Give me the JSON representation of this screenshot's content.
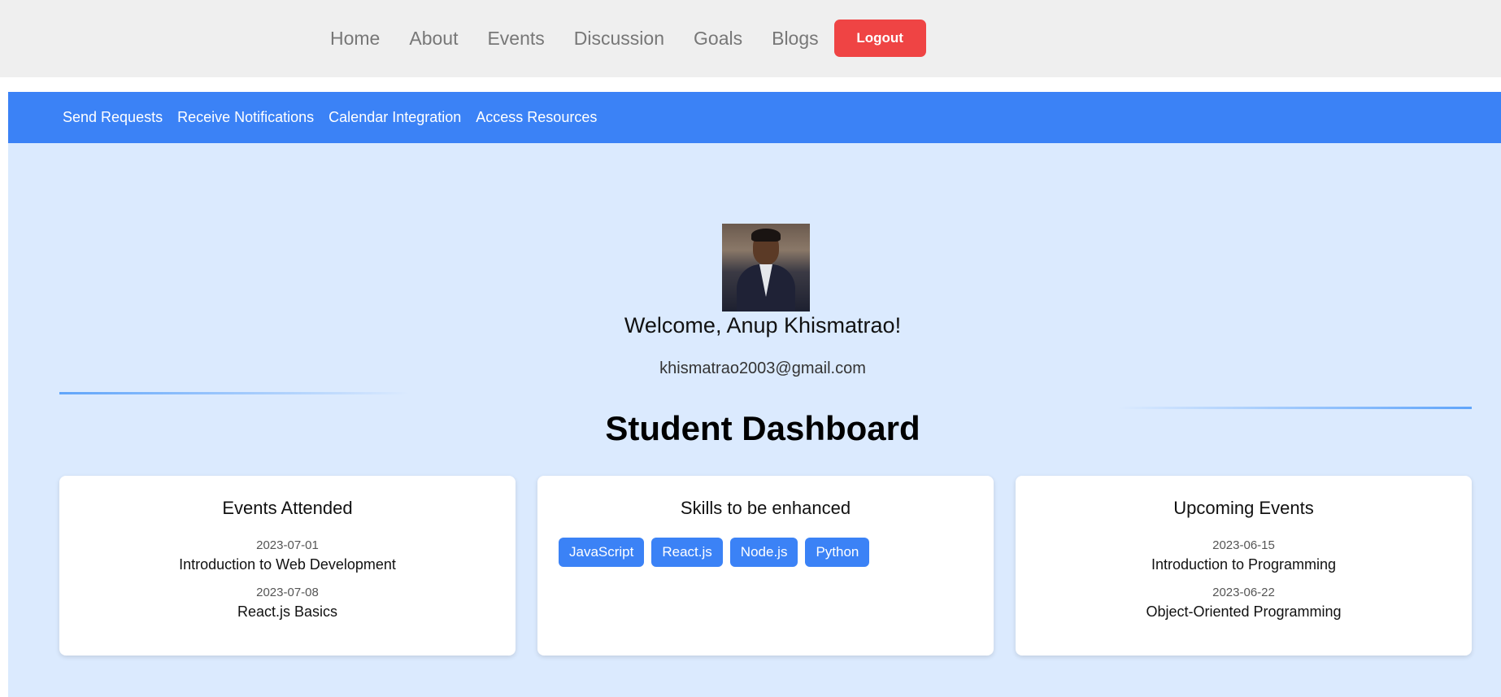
{
  "topnav": {
    "links": [
      "Home",
      "About",
      "Events",
      "Discussion",
      "Goals",
      "Blogs"
    ],
    "logout_label": "Logout"
  },
  "subnav": {
    "links": [
      "Send Requests",
      "Receive Notifications",
      "Calendar Integration",
      "Access Resources"
    ]
  },
  "profile": {
    "welcome": "Welcome, Anup Khismatrao!",
    "email": "khismatrao2003@gmail.com"
  },
  "dashboard": {
    "title": "Student Dashboard",
    "events_attended": {
      "title": "Events Attended",
      "items": [
        {
          "date": "2023-07-01",
          "name": "Introduction to Web Development"
        },
        {
          "date": "2023-07-08",
          "name": "React.js Basics"
        }
      ]
    },
    "skills": {
      "title": "Skills to be enhanced",
      "items": [
        "JavaScript",
        "React.js",
        "Node.js",
        "Python"
      ]
    },
    "upcoming_events": {
      "title": "Upcoming Events",
      "items": [
        {
          "date": "2023-06-15",
          "name": "Introduction to Programming"
        },
        {
          "date": "2023-06-22",
          "name": "Object-Oriented Programming"
        }
      ]
    }
  },
  "colors": {
    "accent": "#3b82f6",
    "logout": "#ef4444",
    "background": "#dbeafe"
  }
}
